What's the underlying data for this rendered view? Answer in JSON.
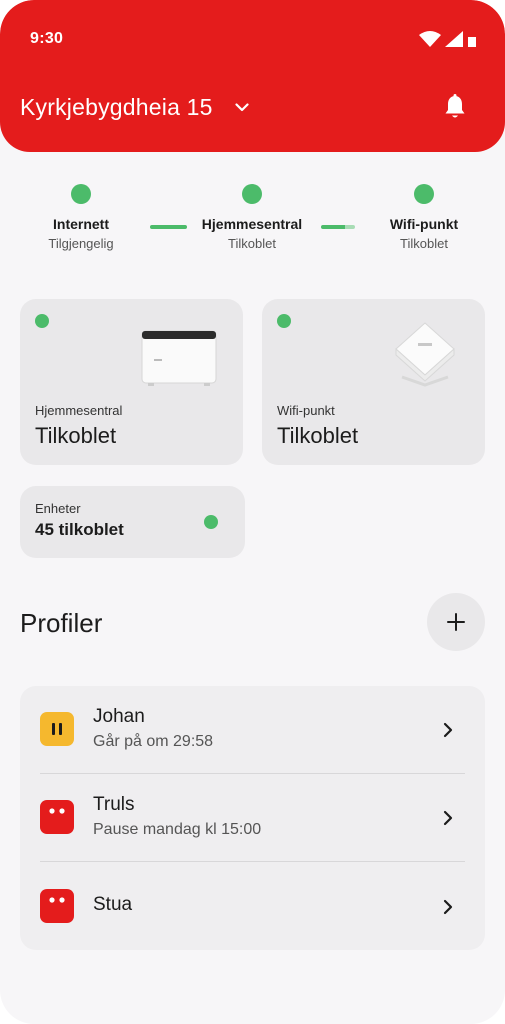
{
  "status_bar": {
    "time": "9:30"
  },
  "header": {
    "address": "Kyrkjebygdheia 15",
    "colors": {
      "brand": "#e41c1c"
    }
  },
  "connection": {
    "internet": {
      "title": "Internett",
      "status": "Tilgjengelig"
    },
    "hub": {
      "title": "Hjemmesentral",
      "status": "Tilkoblet"
    },
    "wifi": {
      "title": "Wifi-punkt",
      "status": "Tilkoblet"
    },
    "status_color": "#4cbb6a"
  },
  "devices": {
    "hub_card": {
      "label": "Hjemmesentral",
      "value": "Tilkoblet"
    },
    "wifi_card": {
      "label": "Wifi-punkt",
      "value": "Tilkoblet"
    },
    "units_card": {
      "label": "Enheter",
      "value": "45 tilkoblet"
    }
  },
  "profiles": {
    "title": "Profiler",
    "add_icon": "plus-icon",
    "items": [
      {
        "name": "Johan",
        "status": "Går på om 29:58",
        "avatar_color": "#f5b82e",
        "icon": "pause-icon"
      },
      {
        "name": "Truls",
        "status": "Pause mandag kl 15:00",
        "avatar_color": "#e41c1c",
        "icon": "face-icon"
      },
      {
        "name": "Stua",
        "status": "",
        "avatar_color": "#e41c1c",
        "icon": "face-icon"
      }
    ]
  }
}
